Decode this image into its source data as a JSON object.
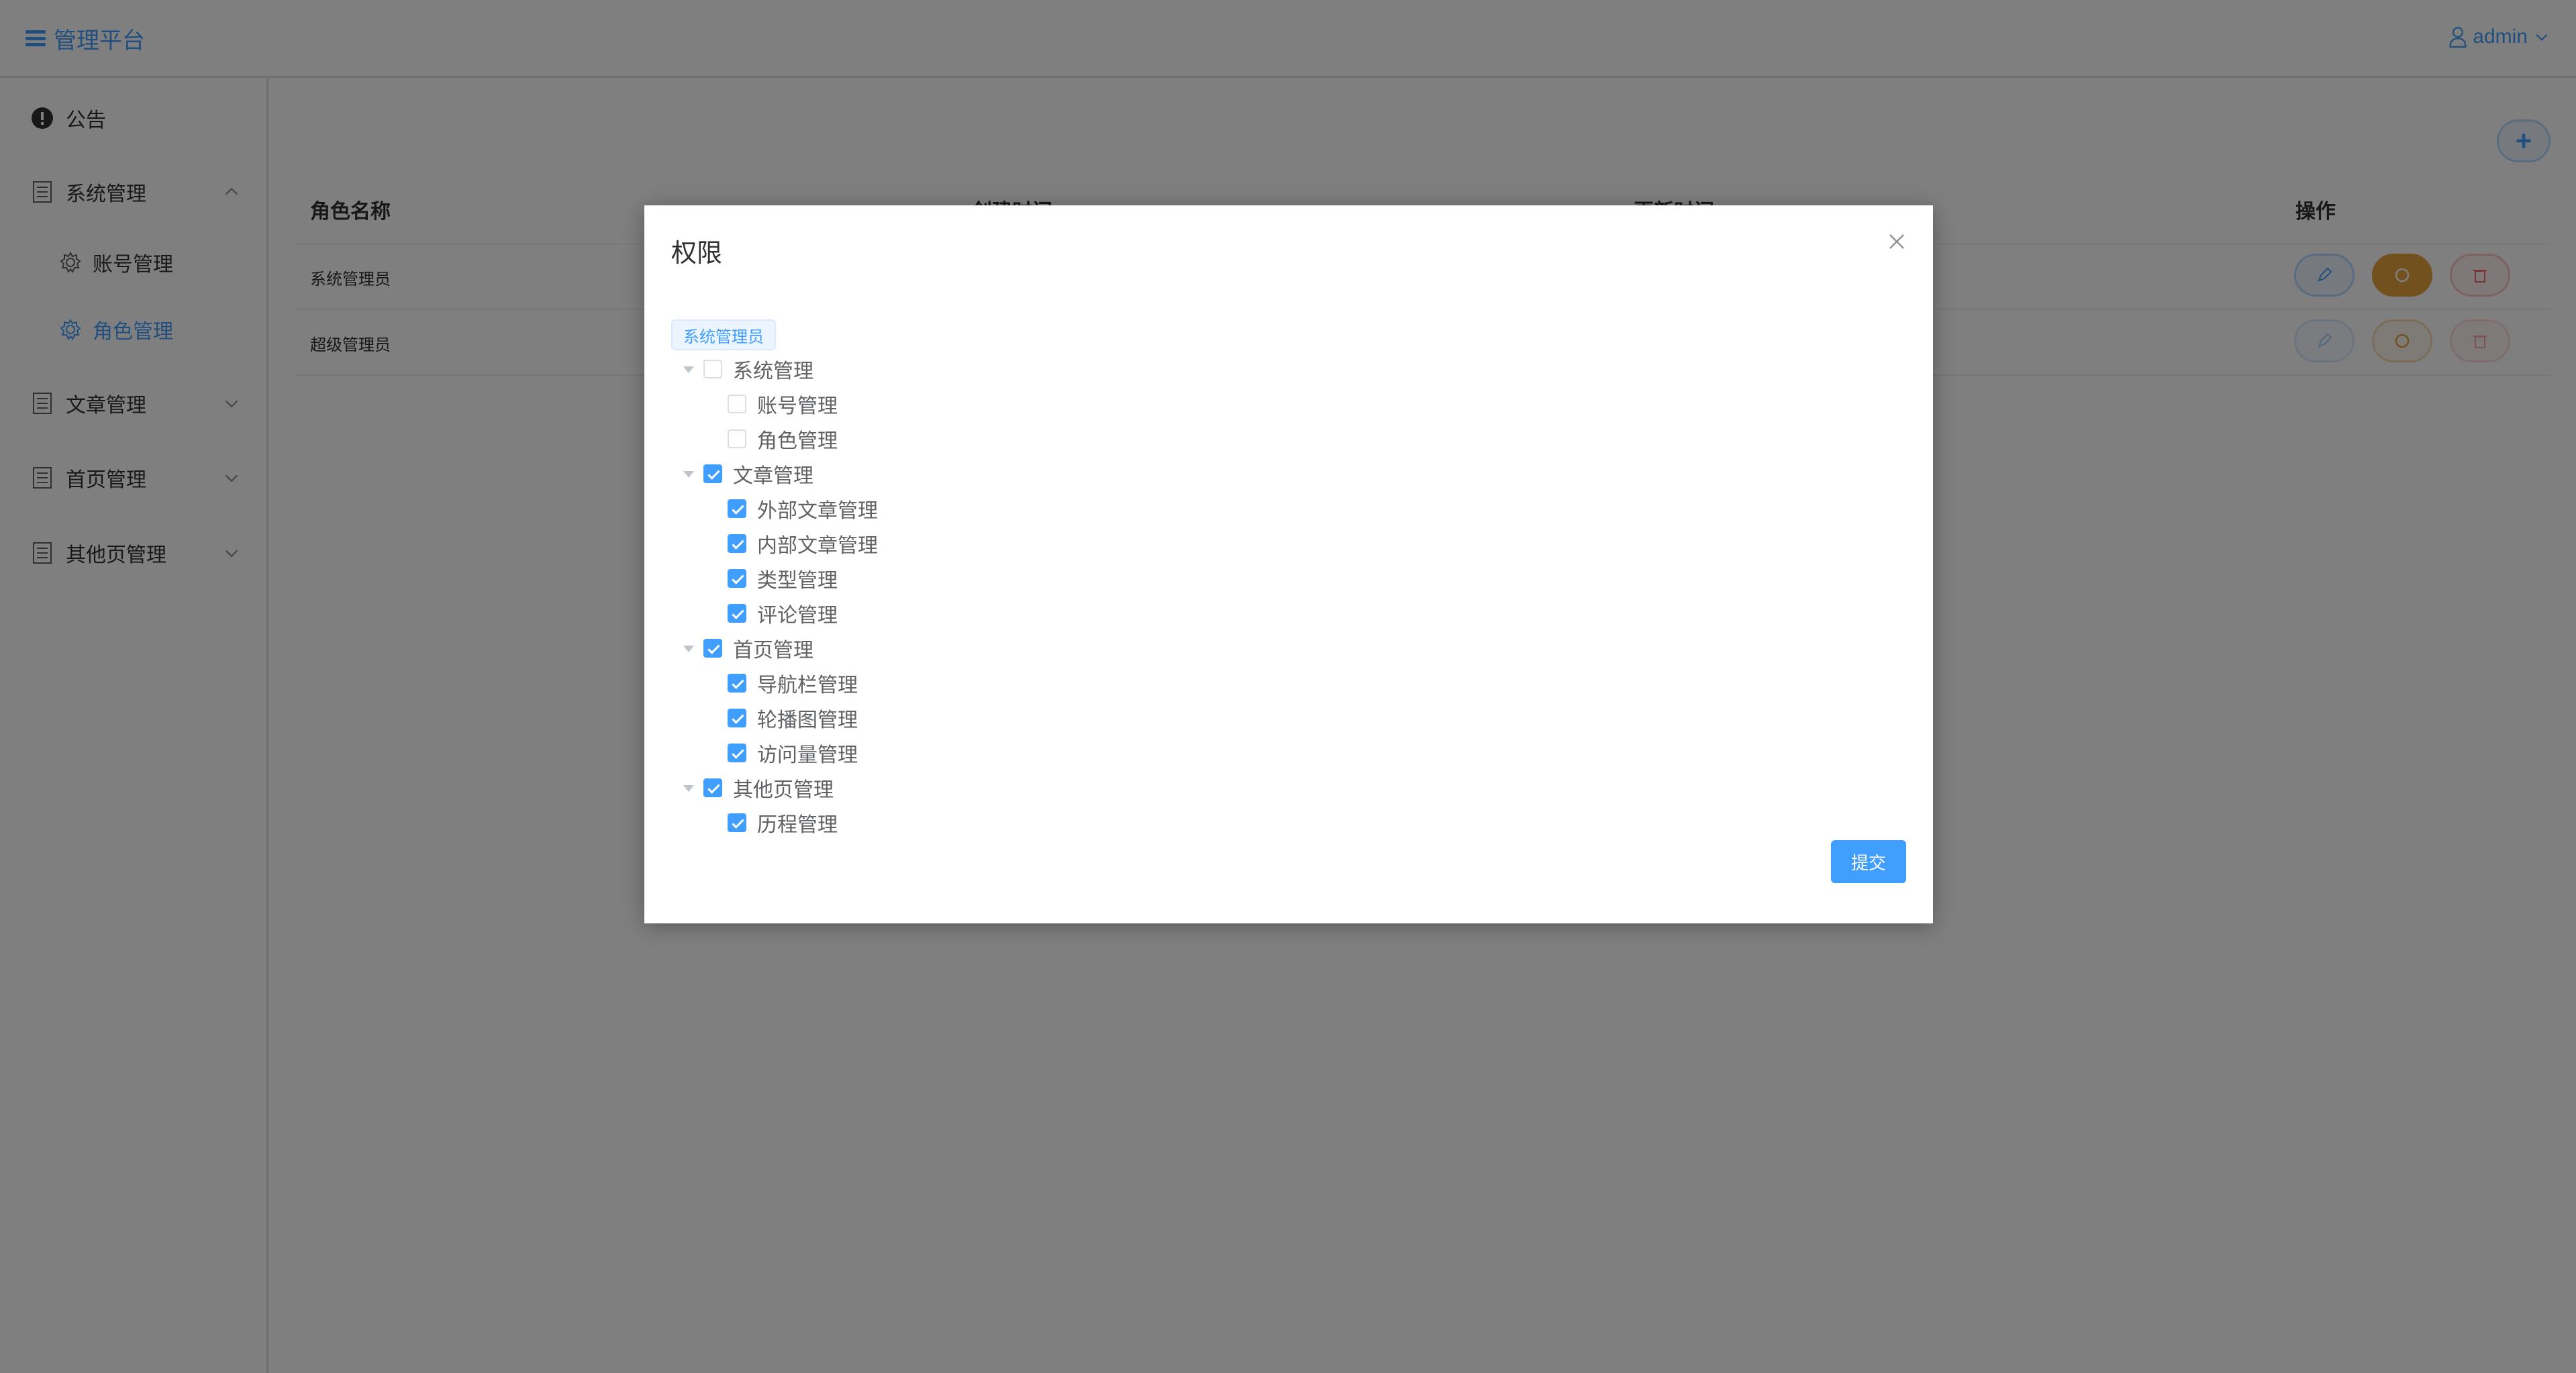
{
  "header": {
    "brand": "管理平台",
    "user": "admin"
  },
  "sidebar": {
    "items": [
      {
        "label": "公告"
      },
      {
        "label": "系统管理"
      },
      {
        "label": "账号管理"
      },
      {
        "label": "角色管理"
      },
      {
        "label": "文章管理"
      },
      {
        "label": "首页管理"
      },
      {
        "label": "其他页管理"
      }
    ]
  },
  "table": {
    "headers": [
      "角色名称",
      "创建时间",
      "更新时间",
      "操作"
    ],
    "rows": [
      {
        "name": "系统管理员"
      },
      {
        "name": "超级管理员"
      }
    ]
  },
  "dialog": {
    "title": "权限",
    "role_tag": "系统管理员",
    "submit_label": "提交",
    "tree": [
      {
        "label": "系统管理",
        "checked": false
      },
      {
        "label": "账号管理",
        "checked": false
      },
      {
        "label": "角色管理",
        "checked": false
      },
      {
        "label": "文章管理",
        "checked": true
      },
      {
        "label": "外部文章管理",
        "checked": true
      },
      {
        "label": "内部文章管理",
        "checked": true
      },
      {
        "label": "类型管理",
        "checked": true
      },
      {
        "label": "评论管理",
        "checked": true
      },
      {
        "label": "首页管理",
        "checked": true
      },
      {
        "label": "导航栏管理",
        "checked": true
      },
      {
        "label": "轮播图管理",
        "checked": true
      },
      {
        "label": "访问量管理",
        "checked": true
      },
      {
        "label": "其他页管理",
        "checked": true
      },
      {
        "label": "历程管理",
        "checked": true
      }
    ]
  },
  "colors": {
    "primary": "#409eff",
    "warning": "#e6a23c",
    "danger": "#f56c6c"
  }
}
